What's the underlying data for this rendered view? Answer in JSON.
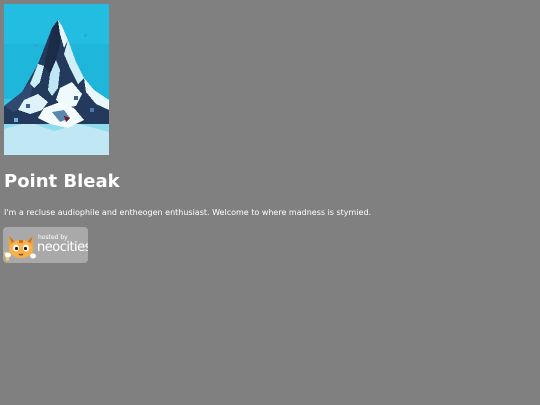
{
  "header": {
    "image_name": "mountain-peak-image"
  },
  "main": {
    "title": "Point Bleak",
    "description": "I'm a recluse audiophile and entheogen enthusiast. Welcome to where madness is stymied."
  },
  "badge": {
    "hosted_label": "hosted by",
    "brand": "neocities",
    "icon": "neocities-cat-icon"
  },
  "colors": {
    "background": "#808080",
    "text": "#ffffff",
    "badge_background": "#a9a9a9",
    "sky": "#1fb6db",
    "ice": "#bfe8f4",
    "rock": "#243a5c"
  }
}
